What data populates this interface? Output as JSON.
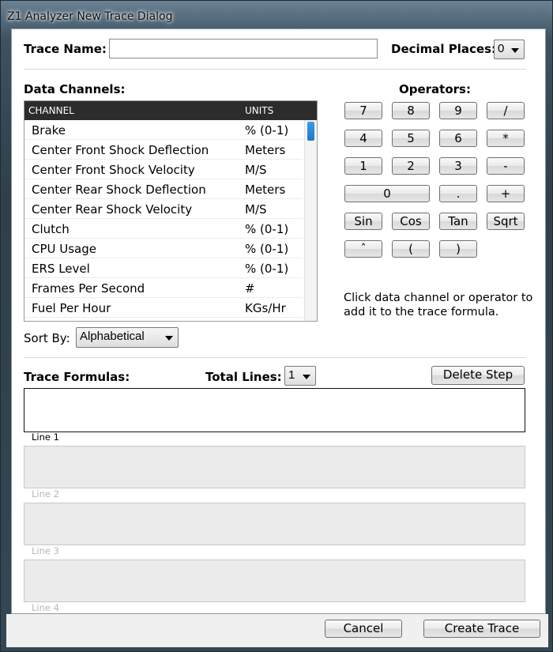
{
  "window": {
    "title": "Z1 Analyzer New Trace Dialog"
  },
  "trace_name": {
    "label": "Trace Name:",
    "value": ""
  },
  "decimal_places": {
    "label": "Decimal Places:",
    "selected": "0"
  },
  "data_channels": {
    "label": "Data Channels:",
    "columns": [
      "CHANNEL",
      "UNITS"
    ],
    "rows": [
      {
        "channel": "Brake",
        "units": "% (0-1)"
      },
      {
        "channel": "Center Front Shock Deflection",
        "units": "Meters"
      },
      {
        "channel": "Center Front Shock Velocity",
        "units": "M/S"
      },
      {
        "channel": "Center Rear Shock Deflection",
        "units": "Meters"
      },
      {
        "channel": "Center Rear Shock Velocity",
        "units": "M/S"
      },
      {
        "channel": "Clutch",
        "units": "% (0-1)"
      },
      {
        "channel": "CPU Usage",
        "units": "% (0-1)"
      },
      {
        "channel": "ERS Level",
        "units": "% (0-1)"
      },
      {
        "channel": "Frames Per Second",
        "units": "#"
      },
      {
        "channel": "Fuel Per Hour",
        "units": "KGs/Hr"
      }
    ]
  },
  "sort_by": {
    "label": "Sort By:",
    "selected": "Alphabetical"
  },
  "operators": {
    "label": "Operators:",
    "buttons": [
      "7",
      "8",
      "9",
      "/",
      "4",
      "5",
      "6",
      "*",
      "1",
      "2",
      "3",
      "-",
      "0",
      ".",
      "+",
      "Sin",
      "Cos",
      "Tan",
      "Sqrt",
      "ˆ",
      "(",
      ")"
    ],
    "hint": "Click data channel or operator to add it to the trace formula."
  },
  "trace_formulas": {
    "label": "Trace Formulas:",
    "total_lines_label": "Total Lines:",
    "total_lines_selected": "1",
    "delete_step_label": "Delete Step",
    "lines": [
      "Line 1",
      "Line 2",
      "Line 3",
      "Line 4"
    ]
  },
  "footer": {
    "cancel_label": "Cancel",
    "create_label": "Create Trace"
  }
}
